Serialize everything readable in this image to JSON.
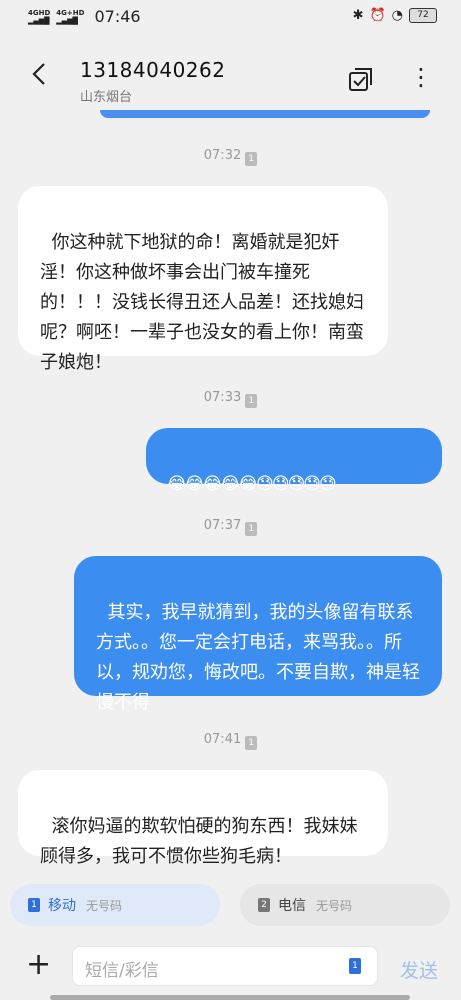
{
  "status_bar": {
    "network1": "4GHD",
    "network2": "4G+HD",
    "time": "07:46",
    "battery": "72"
  },
  "header": {
    "title": "13184040262",
    "subtitle": "山东烟台"
  },
  "timestamps": [
    "07:32",
    "07:33",
    "07:37",
    "07:41"
  ],
  "sim_badge": "1",
  "messages": [
    {
      "direction": "incoming",
      "text": "你这种就下地狱的命！离婚就是犯奸淫！你这种做坏事会出门被车撞死的！！！没钱长得丑还人品差！还找媳妇呢？啊呸！一辈子也没女的看上你！南蛮子娘炮！"
    },
    {
      "direction": "outgoing",
      "text": "😂😂😂😂😂😓😓😓😓😓"
    },
    {
      "direction": "outgoing",
      "text": "其实，我早就猜到，我的头像留有联系方式。。您一定会打电话，来骂我。。所以，规劝您，悔改吧。不要自欺，神是轻慢不得"
    },
    {
      "direction": "incoming",
      "text": "滚你妈逼的欺软怕硬的狗东西！我妹妹顾得多，我可不惯你些狗毛病！"
    }
  ],
  "sim_options": [
    {
      "num": "1",
      "label": "移动",
      "sub": "无号码"
    },
    {
      "num": "2",
      "label": "电信",
      "sub": "无号码"
    }
  ],
  "composer": {
    "placeholder": "短信/彩信",
    "sim": "1",
    "send_label": "发送"
  },
  "colors": {
    "accent": "#3b8df0",
    "background": "#f0f0f0",
    "incoming_bubble": "#ffffff"
  }
}
